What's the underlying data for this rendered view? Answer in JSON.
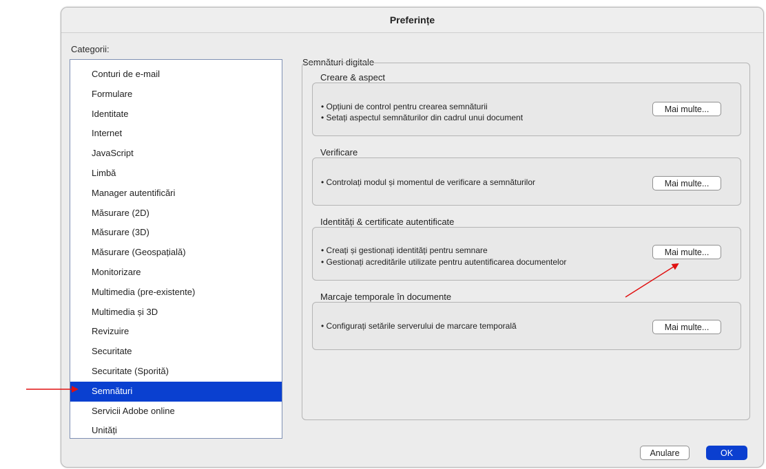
{
  "window": {
    "title": "Preferințe"
  },
  "categories": {
    "label": "Categorii:",
    "items": [
      {
        "label": "Conturi de e-mail"
      },
      {
        "label": "Formulare"
      },
      {
        "label": "Identitate"
      },
      {
        "label": "Internet"
      },
      {
        "label": "JavaScript"
      },
      {
        "label": "Limbă"
      },
      {
        "label": "Manager autentificări"
      },
      {
        "label": "Măsurare (2D)"
      },
      {
        "label": "Măsurare (3D)"
      },
      {
        "label": "Măsurare (Geospațială)"
      },
      {
        "label": "Monitorizare"
      },
      {
        "label": "Multimedia (pre-existente)"
      },
      {
        "label": "Multimedia și 3D"
      },
      {
        "label": "Revizuire"
      },
      {
        "label": "Securitate"
      },
      {
        "label": "Securitate (Sporită)"
      },
      {
        "label": "Semnături",
        "selected": true
      },
      {
        "label": "Servicii Adobe online"
      },
      {
        "label": "Unități"
      }
    ],
    "selected_color": "#0a40d0"
  },
  "main": {
    "section_title": "Semnături digitale",
    "groups": [
      {
        "title": "Creare & aspect",
        "lines": [
          "• Opțiuni de control pentru crearea semnăturii",
          "• Setați aspectul semnăturilor din cadrul unui document"
        ],
        "button": "Mai multe..."
      },
      {
        "title": "Verificare",
        "lines": [
          "• Controlați modul și momentul de verificare a semnăturilor"
        ],
        "button": "Mai multe..."
      },
      {
        "title": "Identități & certificate autentificate",
        "lines": [
          "• Creați și gestionați identități pentru semnare",
          "• Gestionați acreditările utilizate pentru autentificarea documentelor"
        ],
        "button": "Mai multe..."
      },
      {
        "title": "Marcaje temporale în documente",
        "lines": [
          "• Configurați setările serverului de marcare temporală"
        ],
        "button": "Mai multe..."
      }
    ]
  },
  "footer": {
    "cancel_label": "Anulare",
    "ok_label": "OK"
  },
  "annotations": {
    "arrow_color": "#e01010"
  }
}
